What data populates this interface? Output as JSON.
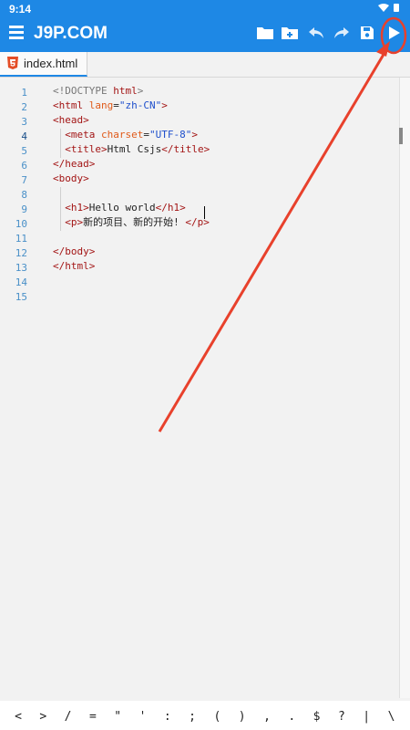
{
  "status_bar": {
    "time": "9:14"
  },
  "toolbar": {
    "title": "J9P.COM",
    "actions": [
      "open-folder-icon",
      "new-file-icon",
      "undo-icon",
      "redo-icon",
      "save-icon",
      "run-icon"
    ],
    "accent_color": "#1e88e5"
  },
  "tabs": [
    {
      "label": "index.html",
      "icon": "html5-icon",
      "active": true
    }
  ],
  "editor": {
    "line_numbers": [
      "1",
      "2",
      "3",
      "4",
      "5",
      "6",
      "7",
      "8",
      "9",
      "10",
      "11",
      "12",
      "13",
      "14",
      "15"
    ],
    "lines": [
      {
        "parts": [
          [
            "doctype",
            "<!DOCTYPE "
          ],
          [
            "tag",
            "html"
          ],
          [
            "doctype",
            ">"
          ]
        ]
      },
      {
        "parts": [
          [
            "tag",
            "<html "
          ],
          [
            "attr",
            "lang"
          ],
          [
            "txt",
            "="
          ],
          [
            "str",
            "\"zh-CN\""
          ],
          [
            "tag",
            ">"
          ]
        ]
      },
      {
        "parts": [
          [
            "tag",
            "<head>"
          ]
        ]
      },
      {
        "parts": [
          [
            "txt",
            "  "
          ],
          [
            "tag",
            "<meta "
          ],
          [
            "attr",
            "charset"
          ],
          [
            "txt",
            "="
          ],
          [
            "str",
            "\"UTF-8\""
          ],
          [
            "tag",
            ">"
          ]
        ]
      },
      {
        "parts": [
          [
            "txt",
            "  "
          ],
          [
            "tag",
            "<title>"
          ],
          [
            "txt",
            "Html Csjs"
          ],
          [
            "tag",
            "</title>"
          ]
        ]
      },
      {
        "parts": [
          [
            "tag",
            "</head>"
          ]
        ]
      },
      {
        "parts": [
          [
            "tag",
            "<body>"
          ]
        ]
      },
      {
        "parts": [
          [
            "txt",
            ""
          ]
        ]
      },
      {
        "parts": [
          [
            "txt",
            "  "
          ],
          [
            "tag",
            "<h1>"
          ],
          [
            "txt",
            "Hello world"
          ],
          [
            "tag",
            "</h1>"
          ]
        ]
      },
      {
        "parts": [
          [
            "txt",
            "  "
          ],
          [
            "tag",
            "<p>"
          ],
          [
            "txt",
            "新的项目、新的开始! "
          ],
          [
            "tag",
            "</p>"
          ]
        ]
      },
      {
        "parts": [
          [
            "txt",
            ""
          ]
        ]
      },
      {
        "parts": [
          [
            "tag",
            "</body>"
          ]
        ]
      },
      {
        "parts": [
          [
            "tag",
            "</html>"
          ]
        ]
      },
      {
        "parts": [
          [
            "txt",
            ""
          ]
        ]
      },
      {
        "parts": [
          [
            "txt",
            ""
          ]
        ]
      }
    ]
  },
  "symbol_keys": [
    "<",
    ">",
    "/",
    "=",
    "\"",
    "'",
    ":",
    ";",
    "(",
    ")",
    ",",
    ".",
    "$",
    "?",
    "|",
    "\\"
  ],
  "annotation": {
    "arrow_color": "#e8412c",
    "highlighted": "run-button"
  }
}
